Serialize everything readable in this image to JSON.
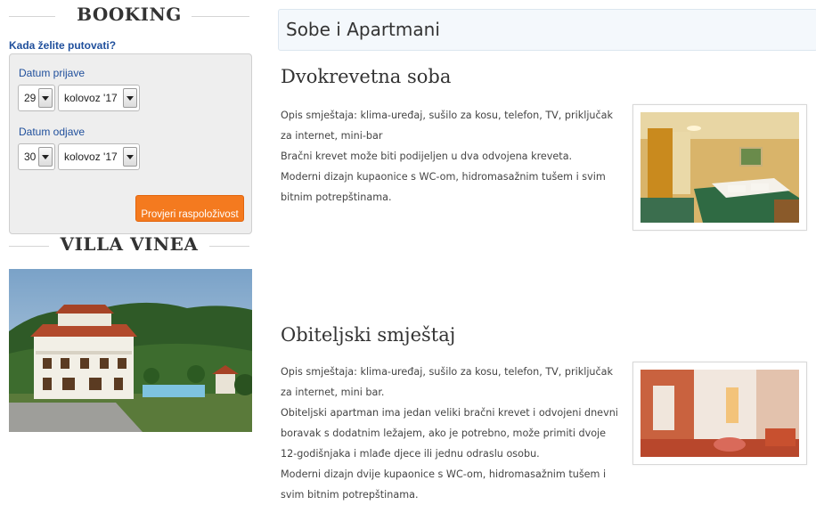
{
  "sidebar": {
    "booking_heading": "BOOKING",
    "question": "Kada želite putovati?",
    "checkin": {
      "label": "Datum prijave",
      "day": "29",
      "month": "kolovoz '17"
    },
    "checkout": {
      "label": "Datum odjave",
      "day": "30",
      "month": "kolovoz '17"
    },
    "check_button": "Provjeri raspoloživost",
    "villa_heading": "VILLA VINEA"
  },
  "main": {
    "title": "Sobe i Apartmani",
    "rooms": [
      {
        "name": "Dvokrevetna soba",
        "paragraphs": [
          "Opis smještaja: klima-uređaj, sušilo za kosu, telefon, TV, priključak za internet, mini-bar",
          "Bračni krevet može biti podijeljen u dva odvojena kreveta.",
          "Moderni dizajn kupaonice s WC-om, hidromasažnim tušem i svim bitnim potrepštinama."
        ]
      },
      {
        "name": "Obiteljski smještaj",
        "paragraphs": [
          "Opis smještaja: klima-uređaj, sušilo za kosu, telefon, TV, priključak za internet, mini bar.",
          "Obiteljski apartman ima jedan veliki bračni krevet i odvojeni dnevni boravak s dodatnim ležajem, ako je potrebno, može primiti dvoje 12-godišnjaka i mlađe djece ili jednu odraslu osobu.",
          "Moderni dizajn dvije kupaonice s WC-om, hidromasažnim tušem i svim bitnim potrepštinama."
        ]
      }
    ]
  },
  "colors": {
    "accent_orange": "#f47a1f",
    "link_blue": "#1f4f9c"
  }
}
